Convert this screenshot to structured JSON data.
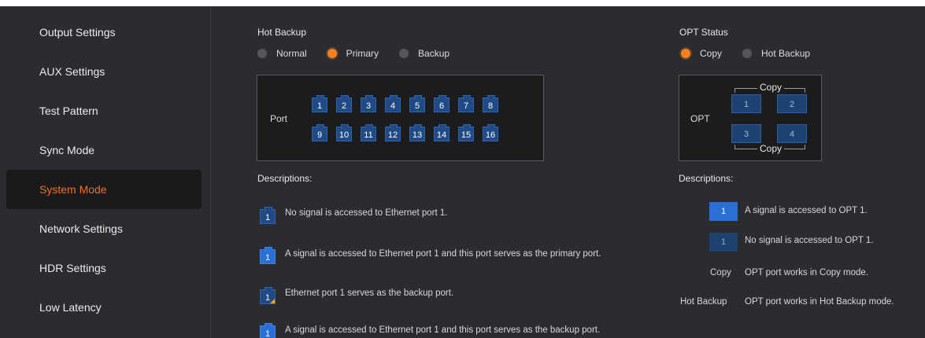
{
  "sidebar": {
    "items": [
      {
        "label": "Output Settings"
      },
      {
        "label": "AUX Settings"
      },
      {
        "label": "Test Pattern"
      },
      {
        "label": "Sync Mode"
      },
      {
        "label": "System Mode",
        "active": true
      },
      {
        "label": "Network Settings"
      },
      {
        "label": "HDR Settings"
      },
      {
        "label": "Low Latency"
      }
    ]
  },
  "hot_backup": {
    "title": "Hot Backup",
    "options": [
      {
        "label": "Normal",
        "selected": false
      },
      {
        "label": "Primary",
        "selected": true
      },
      {
        "label": "Backup",
        "selected": false
      }
    ],
    "port_label": "Port",
    "ports_row1": [
      "1",
      "2",
      "3",
      "4",
      "5",
      "6",
      "7",
      "8"
    ],
    "ports_row2": [
      "9",
      "10",
      "11",
      "12",
      "13",
      "14",
      "15",
      "16"
    ]
  },
  "opt_status": {
    "title": "OPT Status",
    "options": [
      {
        "label": "Copy",
        "selected": true
      },
      {
        "label": "Hot Backup",
        "selected": false
      }
    ],
    "opt_label": "OPT",
    "copy_top": "Copy",
    "copy_bottom": "Copy",
    "boxes": [
      "1",
      "2",
      "3",
      "4"
    ]
  },
  "descriptions_left": {
    "title": "Descriptions:",
    "items": [
      {
        "icon": "1",
        "text": "No signal is accessed to Ethernet port 1."
      },
      {
        "icon": "1",
        "text": "A signal is accessed to Ethernet port 1 and this port serves as the primary port."
      },
      {
        "icon": "1",
        "text": "Ethernet port 1 serves as the backup port."
      },
      {
        "icon": "1",
        "text": "A signal is accessed to Ethernet port 1 and this port serves as the backup port."
      }
    ]
  },
  "descriptions_right": {
    "title": "Descriptions:",
    "items": [
      {
        "key": "1",
        "text": "A signal is accessed to OPT 1."
      },
      {
        "key": "1",
        "text": "No signal is accessed to OPT 1."
      },
      {
        "key": "Copy",
        "text": "OPT port works in Copy mode."
      },
      {
        "key": "Hot Backup",
        "text": "OPT port works in Hot Backup mode."
      }
    ]
  },
  "colors": {
    "accent": "#f26f21",
    "background": "#2b2c30",
    "port_blue": "#1f4a86"
  }
}
